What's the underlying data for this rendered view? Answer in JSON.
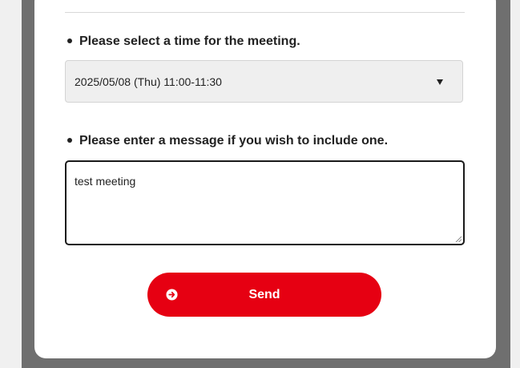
{
  "form": {
    "time_label": "Please select a time for the meeting.",
    "time_value": "2025/05/08 (Thu)  11:00-11:30",
    "message_label": "Please enter a message if you wish to include one.",
    "message_value": "test meeting",
    "send_label": "Send"
  },
  "icons": {
    "select_arrow": "chevron-down-icon",
    "send_icon": "arrow-right-circle-icon",
    "resize": "resize-grip-icon"
  },
  "colors": {
    "accent": "#e60012",
    "backdrop": "#6f6f6f",
    "select_bg": "#efefef"
  }
}
